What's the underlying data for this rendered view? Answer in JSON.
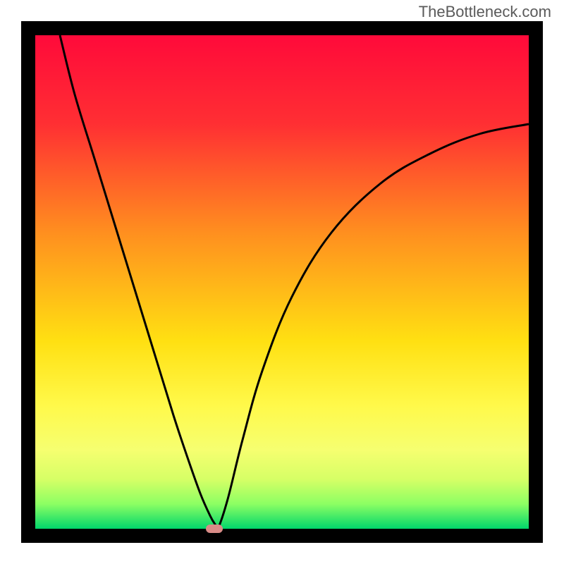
{
  "watermark": "TheBottleneck.com",
  "chart_data": {
    "type": "line",
    "title": "",
    "xlabel": "",
    "ylabel": "",
    "xlim": [
      0,
      100
    ],
    "ylim": [
      0,
      100
    ],
    "grid": false,
    "series": [
      {
        "name": "curve",
        "x": [
          5,
          8,
          12,
          16,
          20,
          24,
          28,
          31,
          33.5,
          35.5,
          36.5,
          37,
          39,
          42,
          46,
          52,
          60,
          70,
          80,
          90,
          100
        ],
        "y": [
          100,
          88,
          75,
          62,
          49,
          36,
          23,
          14,
          7,
          2.5,
          0.8,
          0,
          6,
          18,
          32,
          47,
          60,
          70,
          76,
          80,
          82
        ]
      }
    ],
    "gradient_stops": [
      {
        "offset": 0,
        "color": "#ff0a3a"
      },
      {
        "offset": 18,
        "color": "#ff2f33"
      },
      {
        "offset": 40,
        "color": "#ff8f1f"
      },
      {
        "offset": 62,
        "color": "#ffe012"
      },
      {
        "offset": 75,
        "color": "#fff94a"
      },
      {
        "offset": 84,
        "color": "#f6ff70"
      },
      {
        "offset": 90,
        "color": "#d6ff66"
      },
      {
        "offset": 95,
        "color": "#8cff63"
      },
      {
        "offset": 100,
        "color": "#00d66b"
      }
    ],
    "marker": {
      "x": 36.3,
      "y": 0,
      "w": 3.4,
      "h": 1.6,
      "color": "#d98b87"
    }
  }
}
